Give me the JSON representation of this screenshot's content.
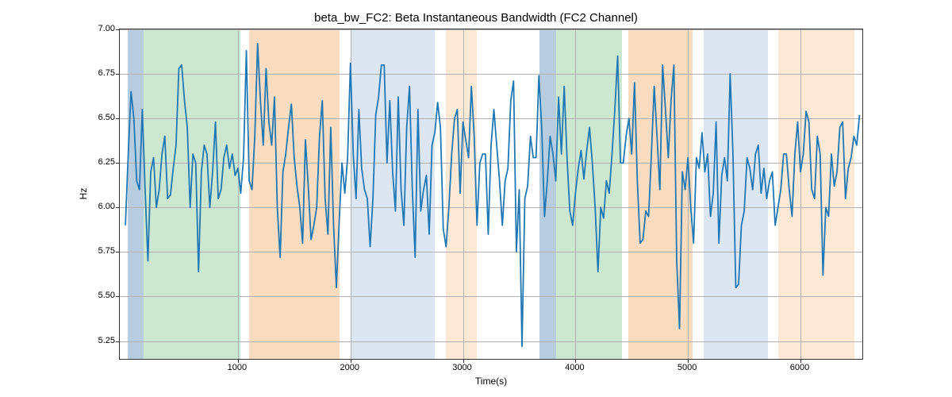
{
  "chart_data": {
    "type": "line",
    "title": "beta_bw_FC2: Beta Instantaneous Bandwidth (FC2 Channel)",
    "xlabel": "Time(s)",
    "ylabel": "Hz",
    "xlim": [
      -50,
      6550
    ],
    "ylim": [
      5.15,
      7.0
    ],
    "xticks": [
      1000,
      2000,
      3000,
      4000,
      5000,
      6000
    ],
    "yticks": [
      5.25,
      5.5,
      5.75,
      6.0,
      6.25,
      6.5,
      6.75,
      7.0
    ],
    "bands": [
      {
        "start": 20,
        "end": 160,
        "color": "#b7cddf"
      },
      {
        "start": 160,
        "end": 1020,
        "color": "#cce7cf"
      },
      {
        "start": 1100,
        "end": 1900,
        "color": "#f9dcc0"
      },
      {
        "start": 2000,
        "end": 2750,
        "color": "#dbe6f2"
      },
      {
        "start": 2850,
        "end": 3120,
        "color": "#fbe9d6"
      },
      {
        "start": 3680,
        "end": 3830,
        "color": "#b7cddf"
      },
      {
        "start": 3830,
        "end": 4410,
        "color": "#cce7cf"
      },
      {
        "start": 4470,
        "end": 5040,
        "color": "#f9dcc0"
      },
      {
        "start": 5140,
        "end": 5710,
        "color": "#dbe6f2"
      },
      {
        "start": 5800,
        "end": 6480,
        "color": "#fbe9d6"
      }
    ],
    "series": [
      {
        "name": "beta_bw_FC2",
        "color": "#1f77b4",
        "x_step": 25,
        "x_start": 0,
        "values": [
          5.9,
          6.3,
          6.65,
          6.5,
          6.15,
          6.1,
          6.55,
          6.1,
          5.7,
          6.2,
          6.28,
          6.0,
          6.1,
          6.3,
          6.4,
          6.05,
          6.07,
          6.22,
          6.35,
          6.78,
          6.8,
          6.6,
          6.45,
          6.0,
          6.3,
          6.25,
          5.64,
          6.2,
          6.35,
          6.3,
          6.0,
          6.2,
          6.48,
          6.05,
          6.1,
          6.28,
          6.35,
          6.22,
          6.3,
          6.18,
          6.22,
          6.08,
          6.28,
          6.88,
          6.15,
          6.1,
          6.4,
          6.92,
          6.6,
          6.35,
          6.78,
          6.48,
          6.35,
          6.62,
          6.0,
          5.72,
          6.2,
          6.3,
          6.45,
          6.58,
          6.28,
          6.12,
          6.0,
          5.8,
          6.38,
          6.12,
          5.82,
          5.9,
          6.0,
          6.4,
          6.6,
          6.05,
          5.85,
          6.45,
          5.9,
          5.55,
          5.92,
          6.25,
          6.08,
          6.28,
          6.81,
          6.3,
          6.05,
          6.55,
          6.22,
          6.1,
          6.05,
          5.78,
          6.05,
          6.52,
          6.62,
          6.8,
          6.8,
          6.25,
          6.6,
          6.2,
          5.98,
          6.62,
          6.1,
          5.9,
          6.45,
          6.68,
          6.1,
          5.72,
          6.55,
          5.98,
          6.1,
          6.18,
          5.85,
          6.35,
          6.42,
          6.59,
          6.45,
          5.88,
          5.78,
          6.0,
          6.3,
          6.5,
          6.55,
          6.08,
          6.48,
          6.38,
          6.28,
          6.68,
          6.4,
          5.9,
          6.25,
          6.3,
          6.3,
          5.85,
          6.35,
          6.55,
          6.35,
          6.15,
          5.9,
          6.15,
          6.22,
          6.6,
          6.71,
          5.75,
          6.1,
          5.22,
          6.05,
          6.12,
          6.4,
          6.28,
          6.28,
          6.74,
          6.45,
          5.95,
          6.15,
          6.4,
          6.3,
          6.15,
          6.62,
          6.3,
          6.68,
          6.28,
          5.98,
          5.9,
          6.08,
          6.22,
          6.32,
          6.16,
          6.32,
          6.45,
          6.25,
          6.0,
          5.64,
          6.0,
          5.94,
          6.15,
          6.08,
          6.3,
          6.55,
          6.85,
          6.25,
          6.25,
          6.4,
          6.5,
          6.3,
          6.7,
          6.15,
          5.8,
          5.82,
          5.98,
          5.95,
          6.3,
          6.68,
          6.4,
          6.1,
          6.8,
          6.55,
          6.28,
          6.6,
          6.8,
          5.7,
          5.32,
          6.2,
          6.1,
          6.28,
          6.0,
          5.8,
          6.28,
          6.22,
          6.42,
          6.2,
          6.3,
          5.95,
          6.08,
          6.48,
          5.8,
          6.18,
          6.28,
          6.15,
          6.75,
          6.3,
          5.55,
          5.57,
          5.9,
          5.98,
          6.28,
          6.22,
          6.1,
          6.3,
          6.35,
          6.08,
          6.22,
          6.05,
          6.15,
          6.2,
          5.9,
          6.0,
          6.1,
          6.3,
          6.3,
          6.1,
          5.95,
          6.3,
          6.48,
          6.2,
          6.3,
          6.54,
          6.48,
          6.1,
          6.05,
          6.4,
          6.3,
          5.62,
          6.0,
          5.95,
          6.3,
          6.12,
          6.2,
          6.45,
          6.48,
          6.05,
          6.22,
          6.28,
          6.4,
          6.35,
          6.52
        ]
      }
    ]
  }
}
